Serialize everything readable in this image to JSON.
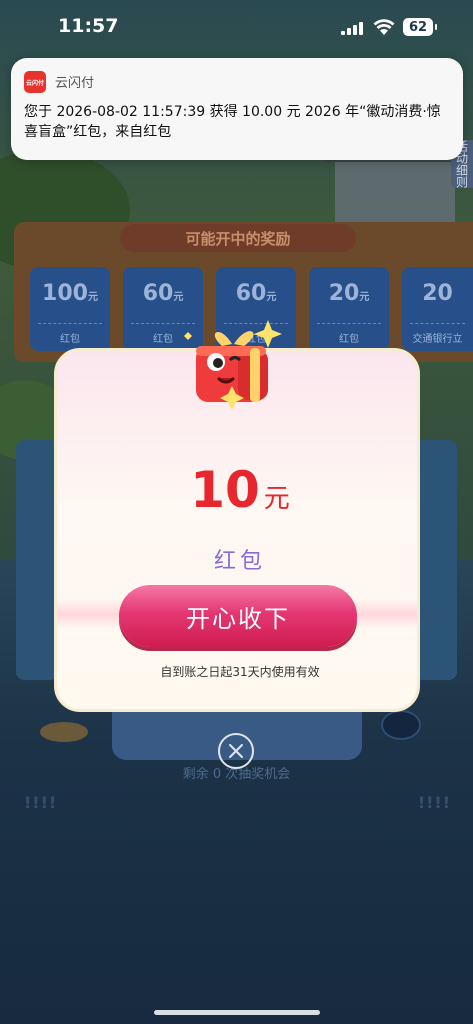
{
  "status_bar": {
    "time": "11:57",
    "battery": "62"
  },
  "notification": {
    "app_icon_text": "云闪付",
    "app_name": "云闪付",
    "message": "您于 2026-08-02 11:57:39 获得 10.00 元 2026 年“徽动消费·惊喜盲盒”红包，来自红包"
  },
  "background": {
    "rules_tab": "活动细则",
    "prize_section_title": "可能开中的奖励",
    "prizes": [
      {
        "amount": "100",
        "unit": "元",
        "label": "红包"
      },
      {
        "amount": "60",
        "unit": "元",
        "label": "红包"
      },
      {
        "amount": "60",
        "unit": "元",
        "label": "红包"
      },
      {
        "amount": "20",
        "unit": "元",
        "label": "红包"
      },
      {
        "amount": "20",
        "unit": "",
        "label": "交通银行立"
      }
    ],
    "remaining_text": "剩余 0 次抽奖机会",
    "marks_left": "!!!!",
    "marks_right": "!!!!"
  },
  "popup": {
    "amount": "10",
    "unit": "元",
    "prize_name": "红包",
    "accept_button": "开心收下",
    "validity": "自到账之日起31天内使用有效"
  },
  "colors": {
    "accent_red": "#e8262d",
    "button_pink": "#e43773",
    "prize_purple": "#8a6bd6"
  }
}
